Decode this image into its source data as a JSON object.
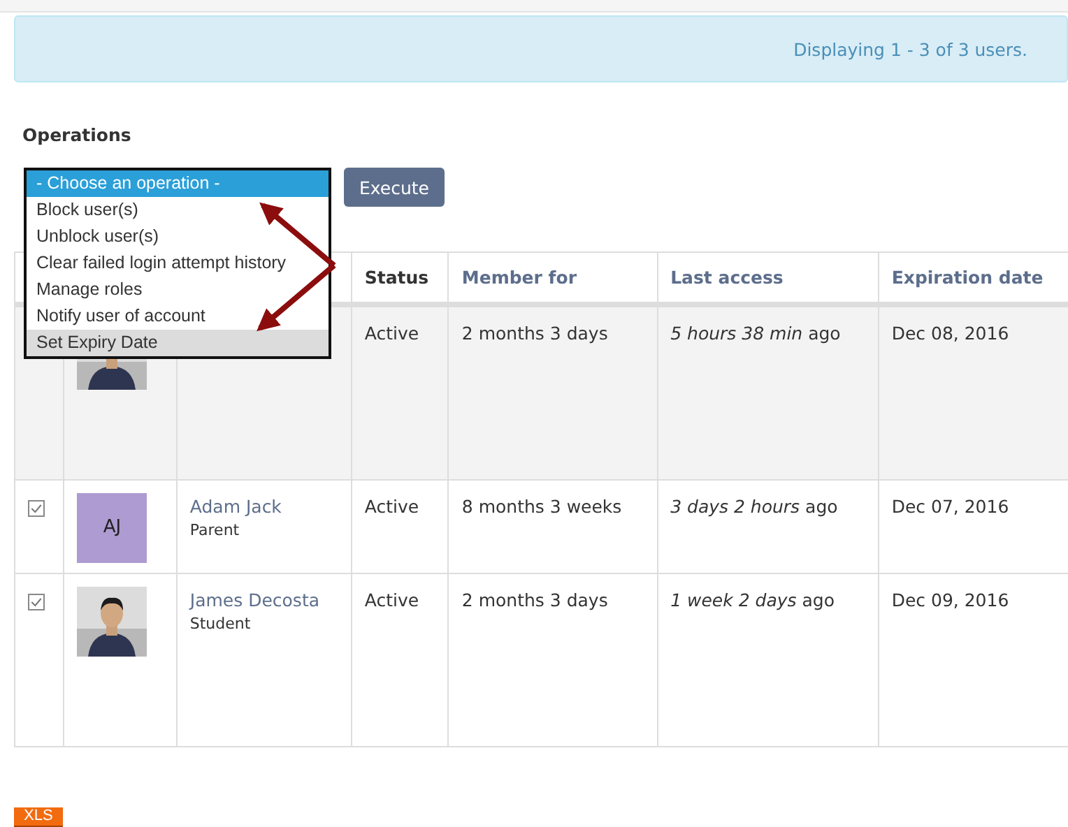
{
  "info_message": "Displaying 1 - 3 of 3 users.",
  "operations": {
    "label": "Operations",
    "options": [
      {
        "label": "- Choose an operation -",
        "selected": true,
        "highlighted": false
      },
      {
        "label": "Block user(s)",
        "selected": false,
        "highlighted": false
      },
      {
        "label": "Unblock user(s)",
        "selected": false,
        "highlighted": false
      },
      {
        "label": "Clear failed login attempt history",
        "selected": false,
        "highlighted": false
      },
      {
        "label": "Manage roles",
        "selected": false,
        "highlighted": false
      },
      {
        "label": "Notify user of account",
        "selected": false,
        "highlighted": false
      },
      {
        "label": "Set Expiry Date",
        "selected": false,
        "highlighted": true
      }
    ],
    "button": "Execute"
  },
  "table": {
    "columns": [
      "Status",
      "Member for",
      "Last access",
      "Expiration date"
    ],
    "rows": [
      {
        "status": "Active",
        "member_for": "2 months 3 days",
        "last_access": "*5 hours 38 min* ago",
        "expiration": "Dec 08, 2016"
      },
      {
        "checked": true,
        "avatar": {
          "kind": "initials",
          "text": "AJ",
          "color": "#ae9bd1"
        },
        "name": "Adam Jack",
        "role": "Parent",
        "status": "Active",
        "member_for": "8 months 3 weeks",
        "last_access": "*3 days 2 hours* ago",
        "expiration": "Dec 07, 2016"
      },
      {
        "checked": true,
        "name": "James Decosta",
        "role": "Student",
        "status": "Active",
        "member_for": "2 months 3 days",
        "last_access": "*1 week 2 days* ago",
        "expiration": "Dec 09, 2016"
      }
    ]
  },
  "export_button": "XLS"
}
